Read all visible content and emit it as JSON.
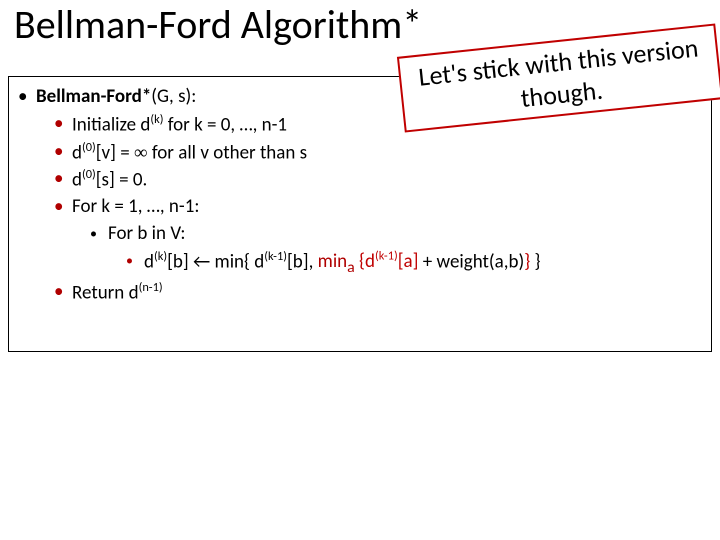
{
  "title": "Bellman-Ford Algorithm*",
  "callout": "Let's stick with this version though.",
  "algo": {
    "header_prefix": "Bellman-Ford*",
    "header_args": "(G, s):",
    "init_prefix": "Initialize d",
    "init_sup": "(k)",
    "init_rest": " for k = 0, …, n-1",
    "dv_prefix": "d",
    "dv_sup": "(0)",
    "dv_mid": "[v] = ",
    "dv_inf": "∞",
    "dv_rest": " for all v other than s",
    "ds_prefix": "d",
    "ds_sup": "(0)",
    "ds_rest": "[s] = 0.",
    "fork": "For k = 1, …, n-1:",
    "forb": "For b in V:",
    "upd_d1": "d",
    "upd_k": "(k)",
    "upd_b1": "[b] ← min{ d",
    "upd_km1a": "(k-1)",
    "upd_b2": "[b],  ",
    "upd_mina": "min",
    "upd_minasub": "a",
    "upd_brace_open": " {",
    "upd_d2": "d",
    "upd_km1b": "(k-1)",
    "upd_a": "[a]  ",
    "upd_weight": "+ weight(a,b)",
    "upd_close1": "}",
    "upd_close2": " }",
    "ret_prefix": "Return d",
    "ret_sup": "(n-1)"
  }
}
